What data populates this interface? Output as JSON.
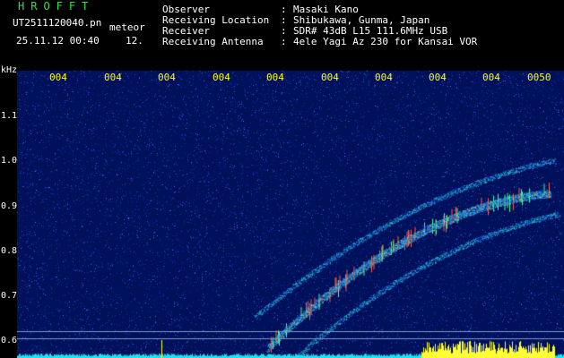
{
  "header": {
    "app_title": "HROFFT",
    "file_name": "UT2511120040.pn",
    "mode_label": "meteor",
    "date_time": "25.11.12 00:40",
    "level_value": "12.",
    "info": [
      {
        "key": "Observer",
        "value": "Masaki Kano"
      },
      {
        "key": "Receiving Location",
        "value": "Shibukawa, Gunma, Japan"
      },
      {
        "key": "Receiver",
        "value": "SDR# 43dB L15 111.6MHz USB"
      },
      {
        "key": "Receiving Antenna",
        "value": "4ele Yagi Az 230 for Kansai VOR"
      }
    ],
    "separator": ":"
  },
  "axis": {
    "unit": "kHz",
    "y_ticks": [
      "1.1",
      "1.0",
      "0.9",
      "0.8",
      "0.7",
      "0.6"
    ],
    "time_labels": [
      "004",
      "004",
      "004",
      "004",
      "004",
      "004",
      "004",
      "004",
      "004",
      "0050"
    ]
  },
  "colors": {
    "background": "#000000",
    "plot_background": "#00105a",
    "title_green": "#2ee04a",
    "time_label_yellow": "#ffff00",
    "baseline_cyan": "#19e6f0",
    "baseline_yellow": "#ffff33"
  }
}
